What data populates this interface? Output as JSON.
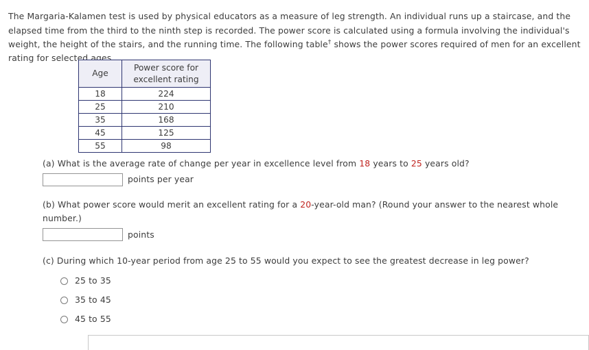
{
  "document": {
    "intro_parts": {
      "before_dagger": "The Margaria-Kalamen test is used by physical educators as a measure of leg strength. An individual runs up a staircase, and the elapsed time from the third to the ninth step is recorded. The power score is calculated using a formula involving the individual's weight, the height of the stairs, and the running time. The following table",
      "dagger": "†",
      "after_dagger": " shows the power scores required of men for an excellent rating for selected ages."
    }
  },
  "table": {
    "headers": [
      "Age",
      "Power score for excellent rating"
    ],
    "rows": [
      {
        "age": "18",
        "score": "224"
      },
      {
        "age": "25",
        "score": "210"
      },
      {
        "age": "35",
        "score": "168"
      },
      {
        "age": "45",
        "score": "125"
      },
      {
        "age": "55",
        "score": "98"
      }
    ]
  },
  "questions": {
    "a": {
      "label": "(a)",
      "text_1": " What is the average rate of change per year in excellence level from ",
      "hl_1": "18",
      "text_2": " years to ",
      "hl_2": "25",
      "text_3": " years old?",
      "input_value": "",
      "unit": "points per year"
    },
    "b": {
      "label": "(b)",
      "text_1": " What power score would merit an excellent rating for a ",
      "hl_1": "20",
      "text_2": "-year-old man? (Round your answer to the nearest whole number.)",
      "input_value": "",
      "unit": "points"
    },
    "c": {
      "label": "(c)",
      "text_1": " During which 10-year period from age 25 to 55 would you expect to see the greatest decrease in leg power?",
      "options": [
        {
          "label": "25 to 35",
          "selected": false
        },
        {
          "label": "35 to 45",
          "selected": false
        },
        {
          "label": "45 to 55",
          "selected": false
        }
      ]
    }
  },
  "colors": {
    "highlight_red": "#c0241f",
    "table_border": "#2d3470",
    "table_header_bg": "#eeeef6",
    "body_text": "#3c3c3c"
  }
}
